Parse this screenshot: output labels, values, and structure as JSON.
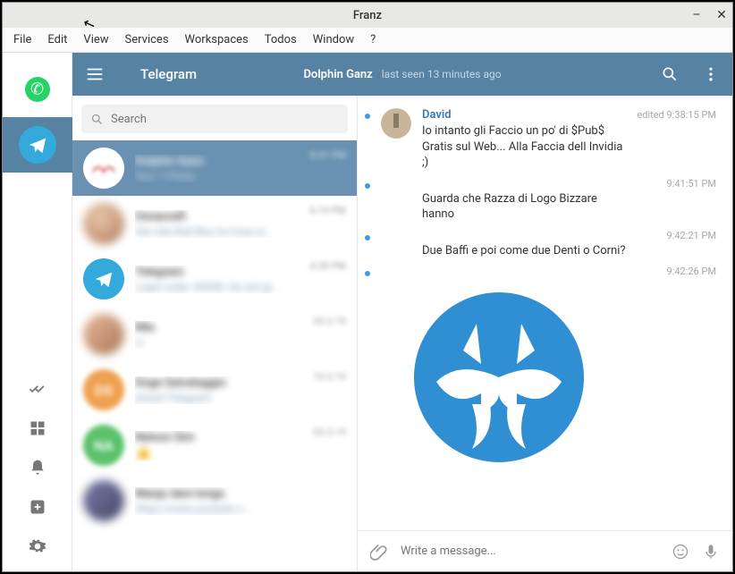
{
  "window": {
    "title": "Franz"
  },
  "menubar": [
    "File",
    "Edit",
    "View",
    "Services",
    "Workspaces",
    "Todos",
    "Window",
    "?"
  ],
  "header": {
    "app": "Telegram",
    "contact": "Dolphin Ganz",
    "status": "last seen 13 minutes ago"
  },
  "search": {
    "placeholder": "Search"
  },
  "chats": [
    {
      "name": "Dolphin Ganz",
      "preview": "You: 1 Photo",
      "time": "8:41 PM",
      "selected": true,
      "avatar": "pink-squiggle"
    },
    {
      "name": "Osnacraft",
      "preview": "Hai vita that Bisz la Cosa si…",
      "time": "6:19 PM",
      "avatar": "face1"
    },
    {
      "name": "Telegram",
      "preview": "Login code: 40438. Do not gi…",
      "time": "4:28 PM",
      "avatar": "telegram"
    },
    {
      "name": "Mia",
      "preview": "ci",
      "time": "05.3.19",
      "avatar": "face2"
    },
    {
      "name": "Doge Salvataggio",
      "preview": "joined Telegram",
      "time": "10.3.19",
      "avatar": "orange-letter",
      "letter": "DS"
    },
    {
      "name": "Nelson Sim",
      "preview": "👍",
      "time": "05.3.19",
      "avatar": "green-letter",
      "letter": "NA"
    },
    {
      "name": "Manju dani longa",
      "preview": "https://www.youtube.c…",
      "time": "",
      "avatar": "face3"
    }
  ],
  "messages": [
    {
      "sender": "David",
      "text": "Io intanto gli Faccio un po' di $Pub$ Gratis sul Web... Alla Faccia dell Invidia ;)",
      "time": "edited 9:38:15 PM",
      "first": true
    },
    {
      "text": "Guarda che Razza di Logo Bizzare hanno",
      "time": "9:41:51 PM"
    },
    {
      "text": "Due Baffi e poi come due Denti o Corni?",
      "time": "9:42:21 PM"
    },
    {
      "sticker": true,
      "time": "9:42:26 PM"
    }
  ],
  "composer": {
    "placeholder": "Write a message..."
  }
}
